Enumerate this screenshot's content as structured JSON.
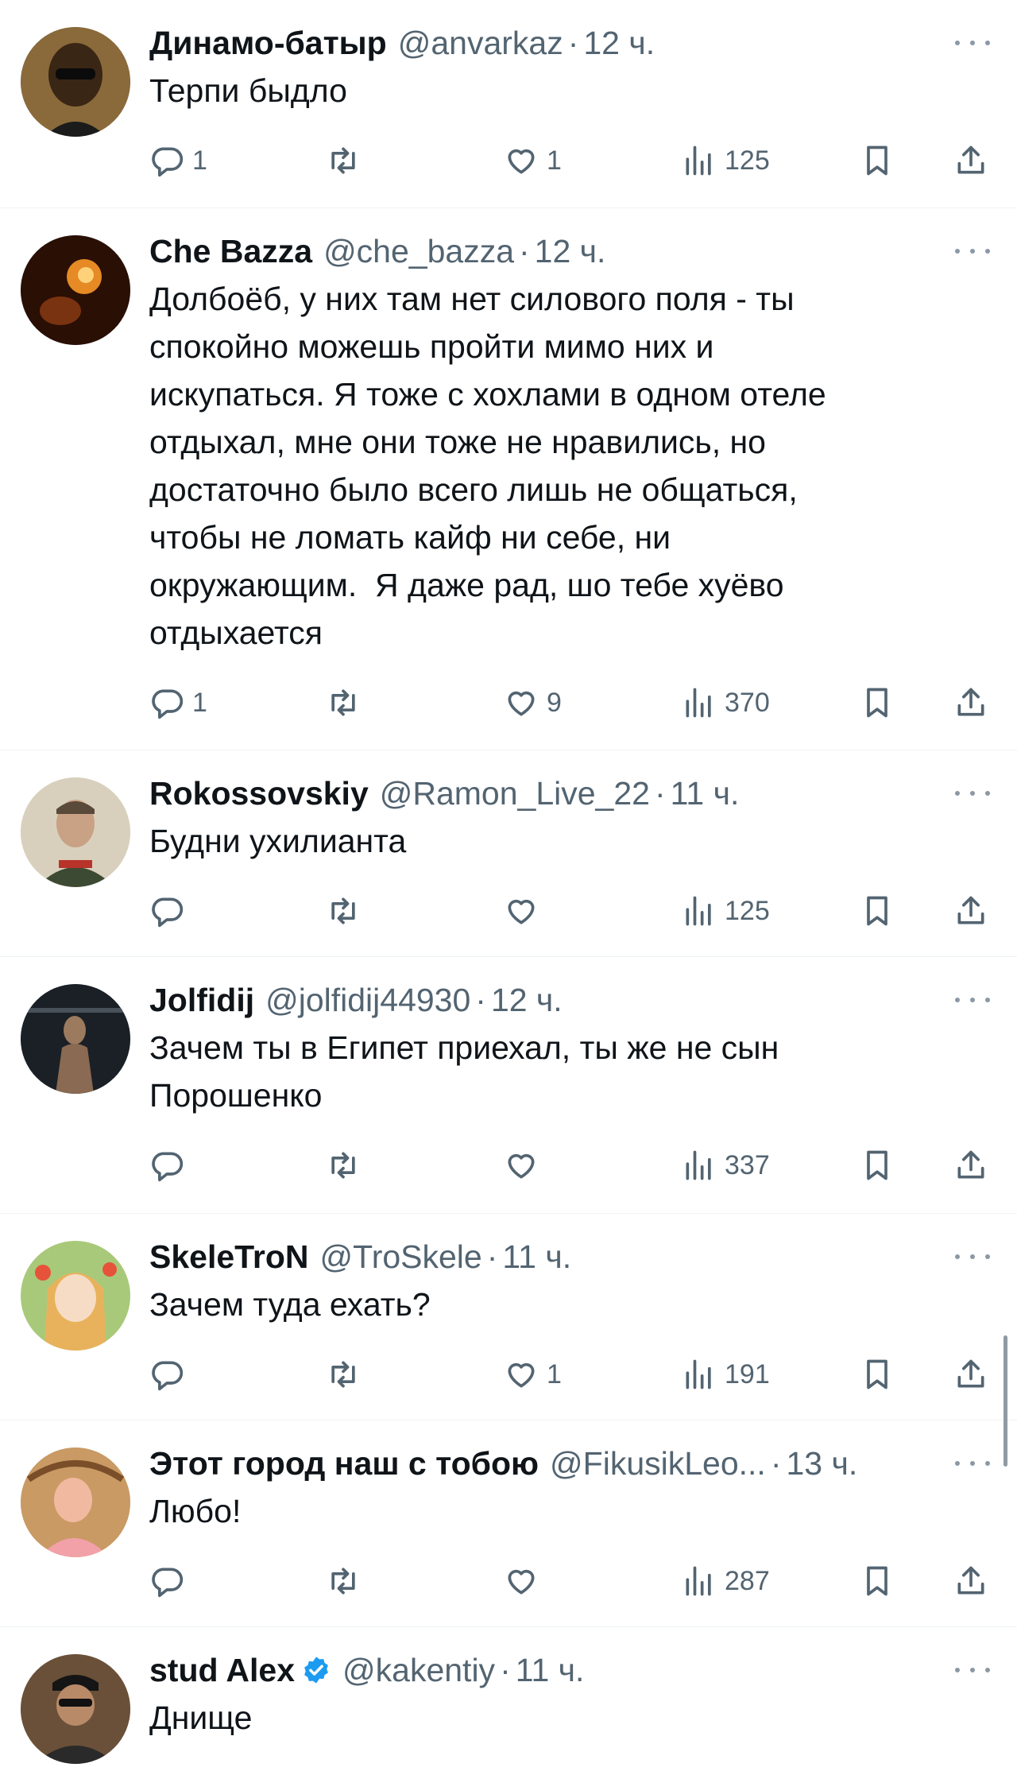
{
  "tweets": [
    {
      "name": "Динамо-батыр",
      "handle": "@anvarkaz",
      "sep": "·",
      "time": "12 ч.",
      "text": "Терпи быдло",
      "replies": "1",
      "retweets": "",
      "likes": "1",
      "views": "125"
    },
    {
      "name": "Che Bazza",
      "handle": "@che_bazza",
      "sep": "·",
      "time": "12 ч.",
      "text": "Долбоёб, у них там нет силового поля - ты\nспокойно можешь пройти мимо них и\nискупаться. Я тоже с хохлами в одном отеле\nотдыхал, мне они тоже не нравились, но\nдостаточно было всего лишь не общаться,\nчтобы не ломать кайф ни себе, ни\nокружающим.  Я даже рад, шо тебе хуёво\nотдыхается",
      "replies": "1",
      "retweets": "",
      "likes": "9",
      "views": "370"
    },
    {
      "name": "Rokossovskiy",
      "handle": "@Ramon_Live_22",
      "sep": "·",
      "time": "11 ч.",
      "text": "Будни ухилианта",
      "replies": "",
      "retweets": "",
      "likes": "",
      "views": "125"
    },
    {
      "name": "Jolfidij",
      "handle": "@jolfidij44930",
      "sep": "·",
      "time": "12 ч.",
      "text": "Зачем ты в Египет приехал, ты же не сын\nПорошенко",
      "replies": "",
      "retweets": "",
      "likes": "",
      "views": "337"
    },
    {
      "name": "SkeleTroN",
      "handle": "@TroSkele",
      "sep": "·",
      "time": "11 ч.",
      "text": "Зачем туда ехать?",
      "replies": "",
      "retweets": "",
      "likes": "1",
      "views": "191"
    },
    {
      "name": "Этот город наш с тобою",
      "handle": "@FikusikLeo...",
      "sep": "·",
      "time": "13 ч.",
      "text": "Любо!",
      "replies": "",
      "retweets": "",
      "likes": "",
      "views": "287"
    },
    {
      "name": "stud Alex",
      "handle": "@kakentiy",
      "sep": "·",
      "time": "11 ч.",
      "text": "Днище",
      "verified": true
    }
  ],
  "icons": {
    "reply": "reply-icon",
    "retweet": "retweet-icon",
    "like": "heart-icon",
    "views": "views-icon",
    "bookmark": "bookmark-icon",
    "share": "share-icon",
    "more": "more-icon",
    "verified": "verified-badge-icon"
  },
  "colors": {
    "text": "#0f1419",
    "muted": "#536471",
    "verified": "#1d9bf0",
    "divider": "#eff3f4"
  }
}
